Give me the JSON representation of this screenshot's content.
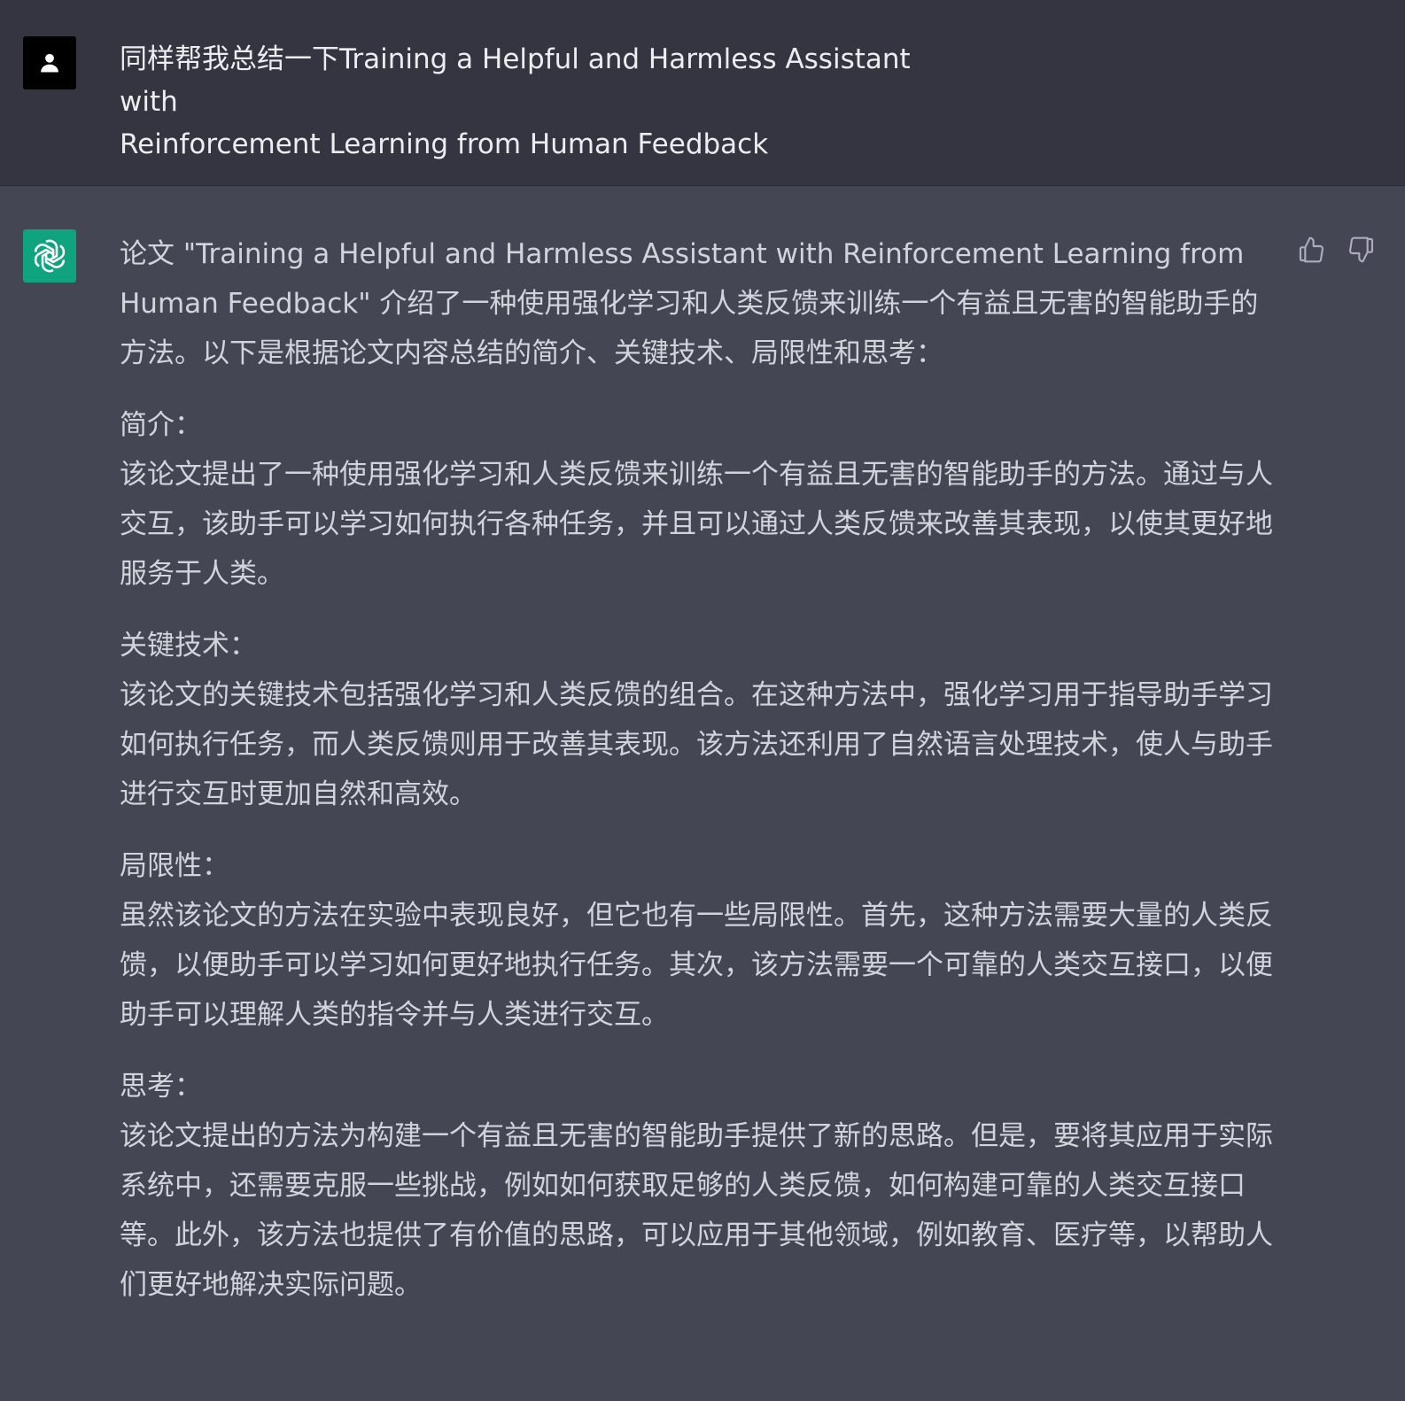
{
  "user_message": {
    "avatar_icon": "user-icon",
    "lines": [
      "同样帮我总结一下Training a Helpful and Harmless Assistant with",
      "Reinforcement Learning from Human Feedback"
    ]
  },
  "assistant_message": {
    "avatar_icon": "openai-logo",
    "avatar_color": "#10a37f",
    "intro": "论文 \"Training a Helpful and Harmless Assistant with Reinforcement Learning from Human Feedback\" 介绍了一种使用强化学习和人类反馈来训练一个有益且无害的智能助手的方法。以下是根据论文内容总结的简介、关键技术、局限性和思考：",
    "sections": [
      {
        "heading": "简介：",
        "body": "该论文提出了一种使用强化学习和人类反馈来训练一个有益且无害的智能助手的方法。通过与人交互，该助手可以学习如何执行各种任务，并且可以通过人类反馈来改善其表现，以使其更好地服务于人类。"
      },
      {
        "heading": "关键技术：",
        "body": "该论文的关键技术包括强化学习和人类反馈的组合。在这种方法中，强化学习用于指导助手学习如何执行任务，而人类反馈则用于改善其表现。该方法还利用了自然语言处理技术，使人与助手进行交互时更加自然和高效。"
      },
      {
        "heading": "局限性：",
        "body": "虽然该论文的方法在实验中表现良好，但它也有一些局限性。首先，这种方法需要大量的人类反馈，以便助手可以学习如何更好地执行任务。其次，该方法需要一个可靠的人类交互接口，以便助手可以理解人类的指令并与人类进行交互。"
      },
      {
        "heading": "思考：",
        "body": "该论文提出的方法为构建一个有益且无害的智能助手提供了新的思路。但是，要将其应用于实际系统中，还需要克服一些挑战，例如如何获取足够的人类反馈，如何构建可靠的人类交互接口等。此外，该方法也提供了有价值的思路，可以应用于其他领域，例如教育、医疗等，以帮助人们更好地解决实际问题。"
      }
    ],
    "feedback": {
      "thumbs_up_icon": "thumbs-up-icon",
      "thumbs_down_icon": "thumbs-down-icon"
    }
  },
  "colors": {
    "user_bg": "#343541",
    "assistant_bg": "#444654",
    "text": "#d1d5db",
    "accent": "#10a37f"
  }
}
